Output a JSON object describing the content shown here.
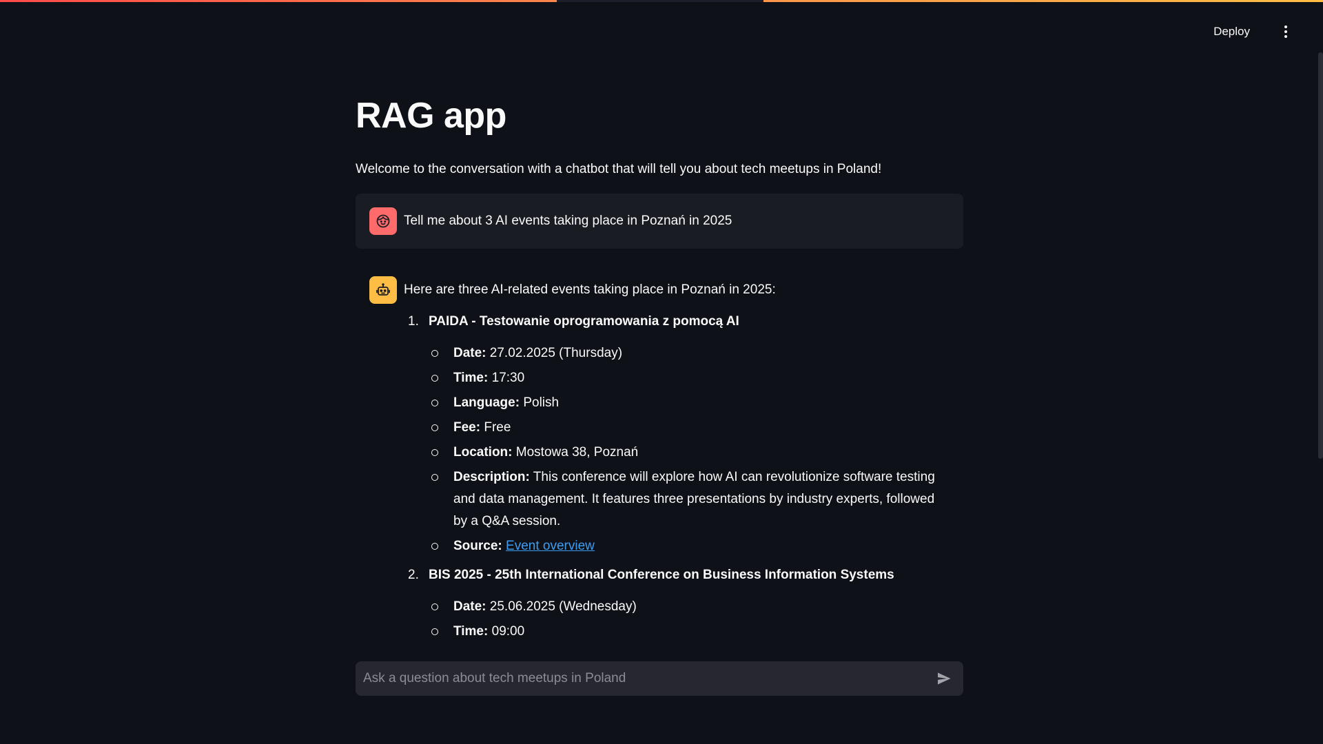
{
  "header": {
    "deploy_label": "Deploy",
    "menu_icon": "kebab-menu-icon"
  },
  "main": {
    "title": "RAG app",
    "intro": "Welcome to the conversation with a chatbot that will tell you about tech meetups in Poland!"
  },
  "messages": {
    "user": {
      "avatar_icon": "user-face-icon",
      "text": "Tell me about 3 AI events taking place in Poznań in 2025"
    },
    "assistant": {
      "avatar_icon": "robot-icon",
      "lead": "Here are three AI-related events taking place in Poznań in 2025:",
      "events": [
        {
          "num": "1.",
          "title": "PAIDA - Testowanie oprogramowania z pomocą AI",
          "details": {
            "date_label": "Date:",
            "date": "27.02.2025 (Thursday)",
            "time_label": "Time:",
            "time": "17:30",
            "language_label": "Language:",
            "language": "Polish",
            "fee_label": "Fee:",
            "fee": "Free",
            "location_label": "Location:",
            "location": "Mostowa 38, Poznań",
            "description_label": "Description:",
            "description": "This conference will explore how AI can revolutionize software testing and data management. It features three presentations by industry experts, followed by a Q&A session.",
            "source_label": "Source:",
            "source_link": "Event overview"
          }
        },
        {
          "num": "2.",
          "title": "BIS 2025 - 25th International Conference on Business Information Systems",
          "details": {
            "date_label": "Date:",
            "date": "25.06.2025 (Wednesday)",
            "time_label": "Time:",
            "time": "09:00"
          }
        }
      ]
    }
  },
  "chat_input": {
    "placeholder": "Ask a question about tech meetups in Poland",
    "value": "",
    "send_icon": "send-icon"
  },
  "colors": {
    "background": "#0e1117",
    "user_avatar": "#ff6b6b",
    "bot_avatar": "#ffbd45",
    "link": "#3d9df3"
  }
}
